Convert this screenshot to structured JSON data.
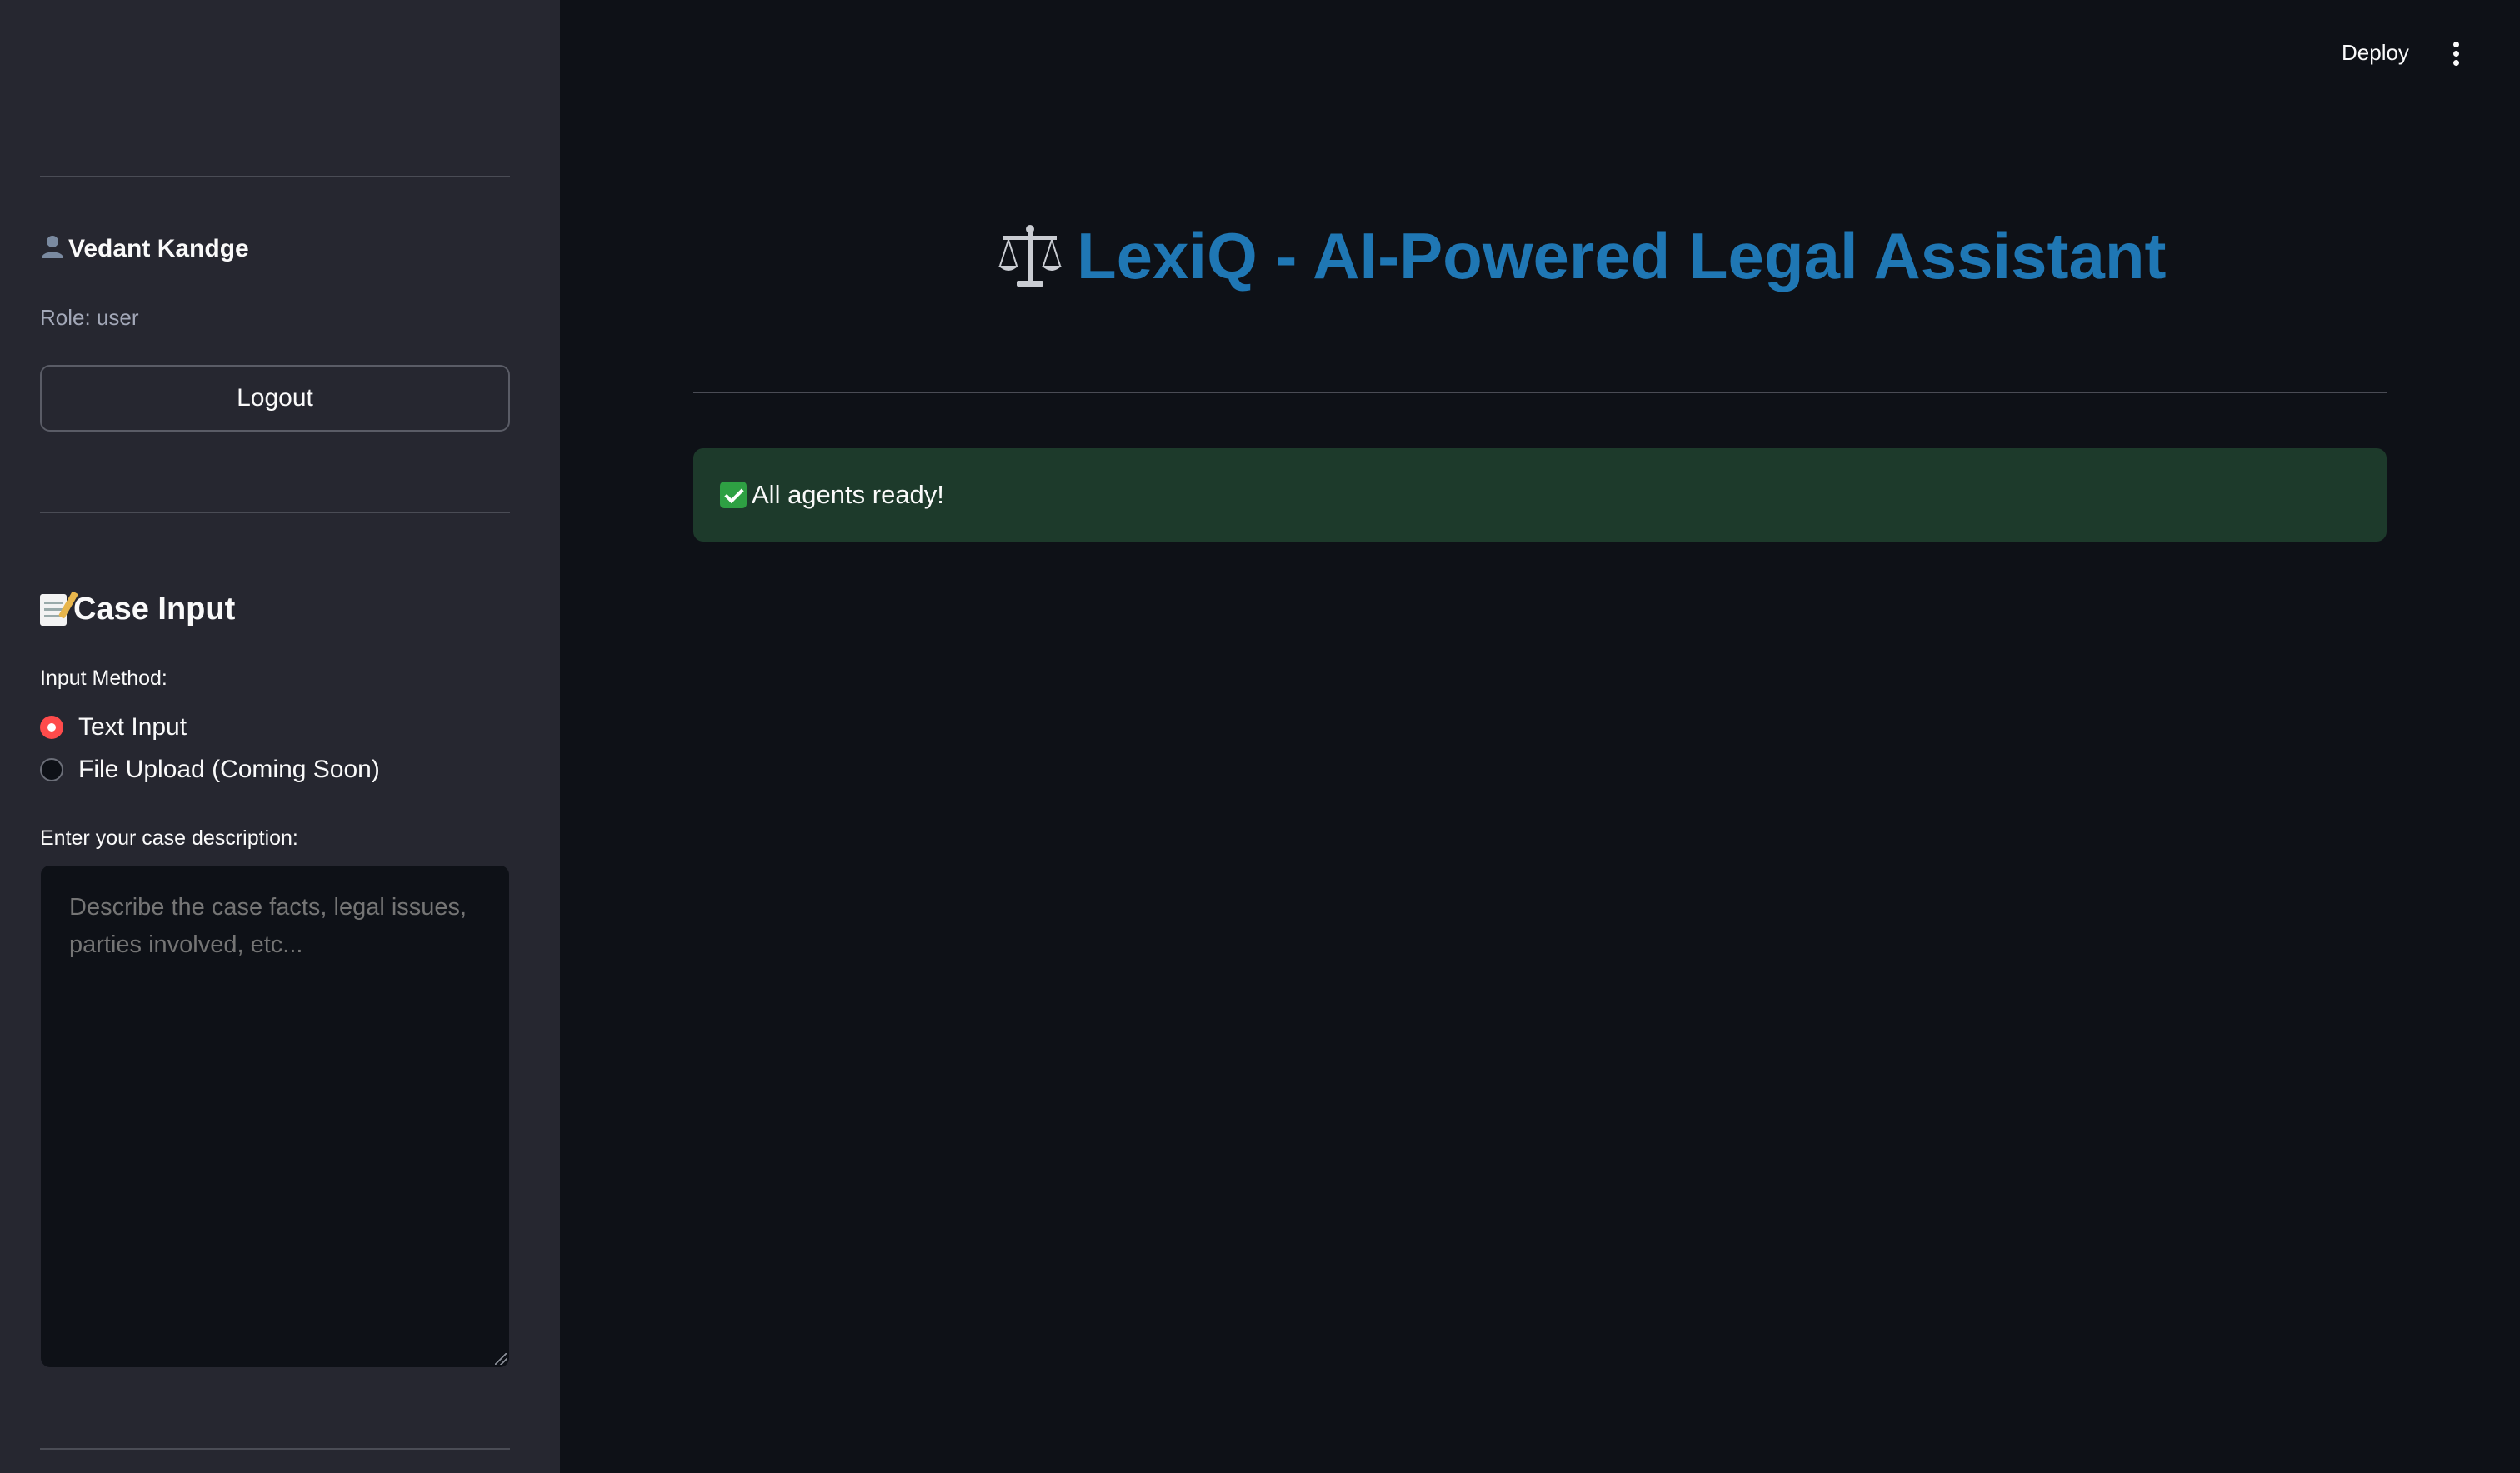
{
  "header": {
    "deploy_label": "Deploy",
    "menu_icon": "vertical-ellipsis-icon"
  },
  "sidebar": {
    "user": {
      "icon": "user-silhouette-icon",
      "name": "Vedant Kandge",
      "role": "Role: user"
    },
    "logout_label": "Logout",
    "case_input": {
      "icon": "memo-icon",
      "title": "Case Input",
      "input_method_label": "Input Method:",
      "options": [
        {
          "label": "Text Input",
          "selected": true
        },
        {
          "label": "File Upload (Coming Soon)",
          "selected": false
        }
      ],
      "description_label": "Enter your case description:",
      "description_value": "",
      "description_placeholder": "Describe the case facts, legal issues, parties involved, etc..."
    }
  },
  "main": {
    "title_icon": "balance-scale-icon",
    "title": "LexiQ - AI-Powered Legal Assistant",
    "status": {
      "icon": "check-mark-icon",
      "text": "All agents ready!",
      "color": "#1d3a2b"
    }
  },
  "colors": {
    "background": "#0e1117",
    "sidebar": "#262730",
    "title": "#1f77b4",
    "radio_accent": "#ff4b4b"
  }
}
